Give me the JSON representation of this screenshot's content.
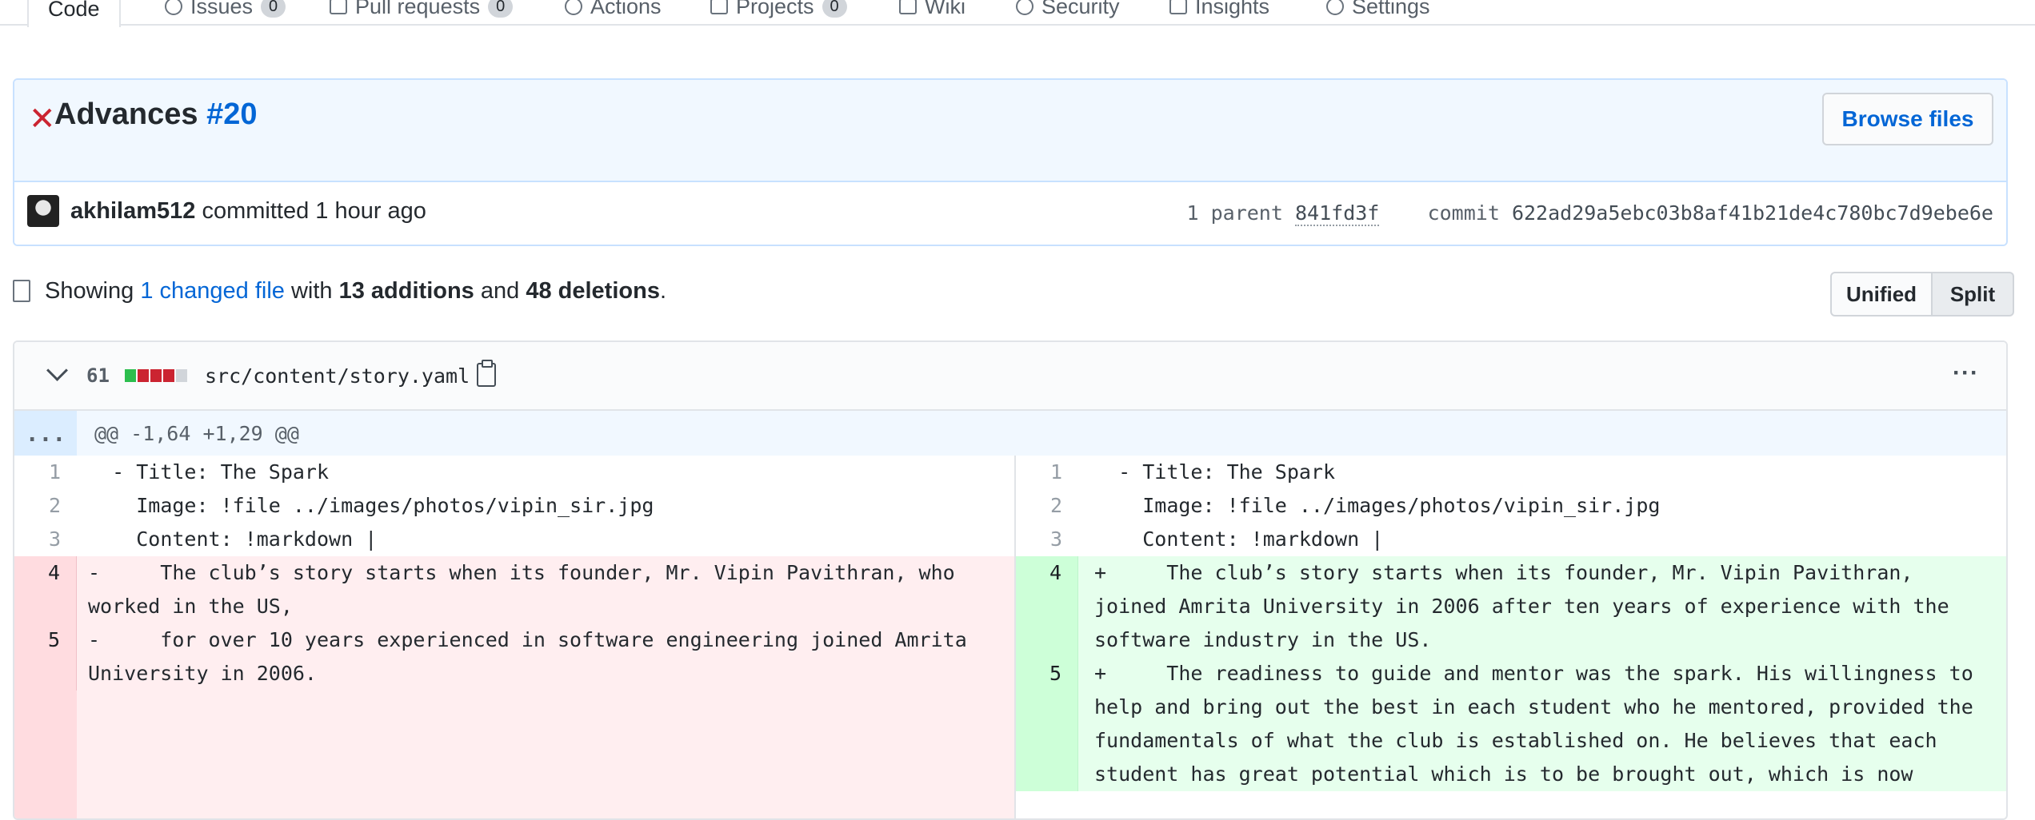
{
  "repo_nav": {
    "tabs": [
      {
        "label": "Code",
        "count": "",
        "selected": true
      },
      {
        "label": "Issues",
        "count": "0",
        "selected": false
      },
      {
        "label": "Pull requests",
        "count": "0",
        "selected": false
      },
      {
        "label": "Actions",
        "count": "",
        "selected": false
      },
      {
        "label": "Projects",
        "count": "0",
        "selected": false
      },
      {
        "label": "Wiki",
        "count": "",
        "selected": false
      },
      {
        "label": "Security",
        "count": "",
        "selected": false
      },
      {
        "label": "Insights",
        "count": "",
        "selected": false
      },
      {
        "label": "Settings",
        "count": "",
        "selected": false
      }
    ]
  },
  "commit": {
    "status_icon": "x-icon",
    "title": "Advances",
    "pr_ref": "#20",
    "browse_files_label": "Browse files",
    "author": "akhilam512",
    "action_text": "committed 1 hour ago",
    "parent_label": "1 parent",
    "parent_sha": "841fd3f",
    "commit_label": "commit",
    "commit_sha": "622ad29a5ebc03b8af41b21de4c780bc7d9ebe6e"
  },
  "summary": {
    "prefix": "Showing",
    "changed_files": "1 changed file",
    "with": "with",
    "additions": "13 additions",
    "and": "and",
    "deletions": "48 deletions",
    "suffix": "."
  },
  "view_toggle": {
    "unified_label": "Unified",
    "split_label": "Split",
    "selected": "Split"
  },
  "diff_file": {
    "count": "61",
    "path": "src/content/story.yaml",
    "hunk_expand": "...",
    "hunk_header": "@@ -1,64 +1,29 @@",
    "left": [
      {
        "num": "1",
        "text": "  - Title: The Spark",
        "type": "ctx"
      },
      {
        "num": "2",
        "text": "    Image: !file ../images/photos/vipin_sir.jpg",
        "type": "ctx"
      },
      {
        "num": "3",
        "text": "    Content: !markdown |",
        "type": "ctx"
      },
      {
        "num": "4",
        "text": "-     The club’s story starts when its founder, Mr. Vipin Pavithran, who worked in the US,\n",
        "type": "del"
      },
      {
        "num": "5",
        "text": "-     for over 10 years experienced in software engineering joined Amrita University in 2006.",
        "type": "del"
      }
    ],
    "right": [
      {
        "num": "1",
        "text": "  - Title: The Spark",
        "type": "ctx"
      },
      {
        "num": "2",
        "text": "    Image: !file ../images/photos/vipin_sir.jpg",
        "type": "ctx"
      },
      {
        "num": "3",
        "text": "    Content: !markdown |",
        "type": "ctx"
      },
      {
        "num": "4",
        "text": "+     The club’s story starts when its founder, Mr. Vipin Pavithran, joined Amrita University in 2006 after ten years of experience with the software industry in the US.",
        "type": "add"
      },
      {
        "num": "5",
        "text": "+     The readiness to guide and mentor was the spark. His willingness to help and bring out the best in each student who he mentored, provided the fundamentals of what the club is established on. He believes that each student has great potential which is to be brought out, which is now",
        "type": "add"
      }
    ]
  }
}
